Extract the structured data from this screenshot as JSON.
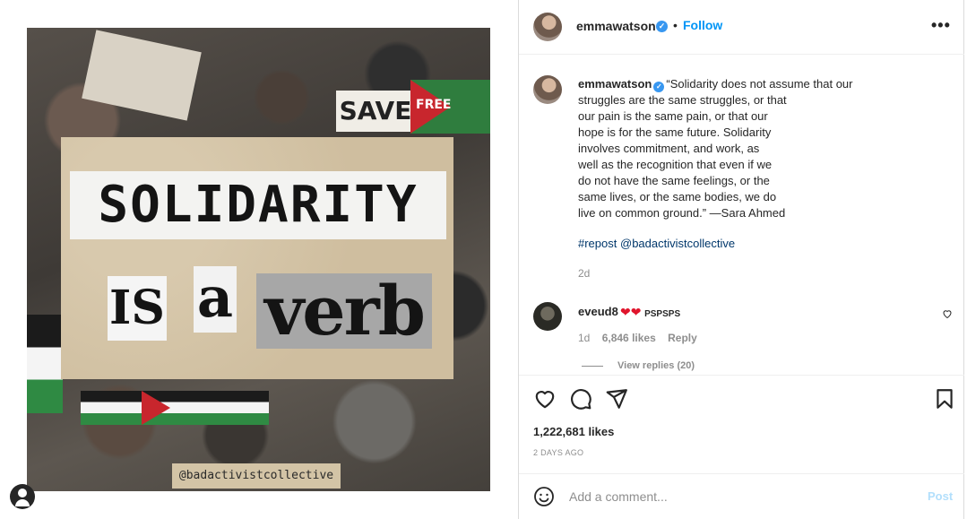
{
  "image": {
    "sign_save": "SAVE",
    "sign_free": "FREE",
    "words": {
      "solidarity": "SOLIDARITY",
      "is": "IS",
      "a": "a",
      "verb": "verb"
    },
    "watermark": "@badactivistcollective"
  },
  "header": {
    "username": "emmawatson",
    "verified_icon": "verified-badge-icon",
    "separator": "•",
    "follow_label": "Follow",
    "more_label": "•••"
  },
  "caption": {
    "username": "emmawatson",
    "lines": [
      "“Solidarity does not assume that our",
      "struggles are the same struggles, or that",
      "our pain is the same pain, or that our",
      "hope is for the same future. Solidarity",
      "involves commitment, and work, as",
      "well as the recognition that even if we",
      "do not have the same feelings, or the",
      "same lives, or the same bodies, we do",
      "live on common ground.” —Sara Ahmed"
    ],
    "hashtag": "#repost",
    "mention": "@badactivistcollective",
    "time": "2d"
  },
  "comment": {
    "username": "eveud8",
    "hearts": "❤❤",
    "text_tail": "PSPSPS",
    "age": "1d",
    "likes": "6,846 likes",
    "reply_label": "Reply",
    "view_replies": "View replies (20)"
  },
  "actions": {
    "likes_count": "1,222,681 likes",
    "date": "2 DAYS AGO"
  },
  "comment_box": {
    "placeholder": "Add a comment...",
    "post_label": "Post"
  },
  "colors": {
    "accent": "#0095f6",
    "verified": "#3897f0",
    "muted": "#8e8e8e",
    "post_disabled": "#b2dffc"
  }
}
